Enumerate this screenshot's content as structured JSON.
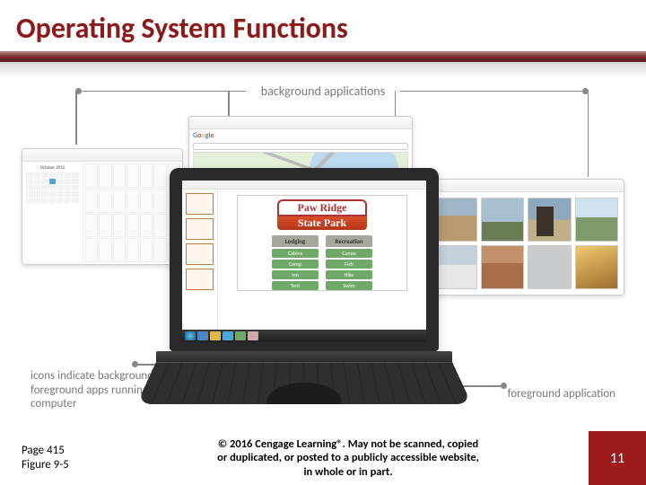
{
  "title": "Operating System Functions",
  "figure": {
    "background_label": "background applications",
    "foreground_label": "foreground application",
    "icons_caption": "icons indicate background and foreground apps running on computer",
    "calendar": {
      "month_label": "October 2015"
    },
    "map": {
      "brand": "Google"
    },
    "park": {
      "name": "Paw Ridge",
      "subtitle": "State Park",
      "sections": {
        "lodging": {
          "header": "Lodging",
          "items": [
            "Cabins",
            "Camp",
            "Inn",
            "Tent"
          ]
        },
        "recreation": {
          "header": "Recreation",
          "items": [
            "Canoe",
            "Fish",
            "Hike",
            "Swim"
          ]
        }
      }
    }
  },
  "footer": {
    "page_ref": "Page 415",
    "figure_ref": "Figure 9-5",
    "copyright_l1": "© 2016 Cengage Learning®. May not be scanned, copied",
    "copyright_l2": "or duplicated, or posted to a publicly accessible website,",
    "copyright_l3": "in whole or in part.",
    "slide_number": "11"
  }
}
